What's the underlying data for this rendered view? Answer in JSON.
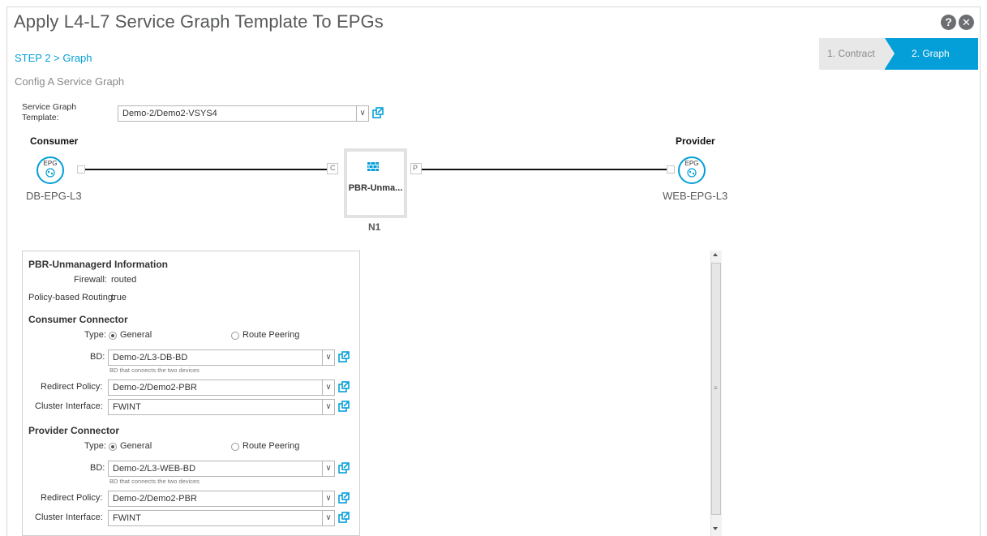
{
  "window": {
    "title": "Apply L4-L7 Service Graph Template To EPGs"
  },
  "header": {
    "help_icon": "question-mark",
    "close_icon": "x"
  },
  "breadcrumb": {
    "text": "STEP 2 > Graph"
  },
  "subtitle": "Config A Service Graph",
  "wizard": {
    "steps": [
      {
        "label": "1. Contract",
        "active": false
      },
      {
        "label": "2. Graph",
        "active": true
      }
    ],
    "accent": "#049fd9"
  },
  "template_field": {
    "label": "Service Graph Template:",
    "value": "Demo-2/Demo2-VSYS4"
  },
  "graph": {
    "consumer": {
      "title": "Consumer",
      "badge": "EPG",
      "name": "DB-EPG-L3"
    },
    "provider": {
      "title": "Provider",
      "badge": "EPG",
      "name": "WEB-EPG-L3"
    },
    "node": {
      "name": "PBR-Unma...",
      "id": "N1",
      "port_c": "C",
      "port_p": "P"
    }
  },
  "info": {
    "heading": "PBR-Unmanagerd Information",
    "firewall_label": "Firewall:",
    "firewall_value": "routed",
    "pbr_label": "Policy-based Routing:",
    "pbr_value": "true",
    "consumer": {
      "heading": "Consumer Connector",
      "type_label": "Type:",
      "type_general": "General",
      "type_route_peering": "Route Peering",
      "type_selected": "General",
      "bd_label": "BD:",
      "bd_value": "Demo-2/L3-DB-BD",
      "bd_hint": "BD that connects the two devices",
      "redirect_label": "Redirect Policy:",
      "redirect_value": "Demo-2/Demo2-PBR",
      "cluster_label": "Cluster Interface:",
      "cluster_value": "FWINT"
    },
    "provider": {
      "heading": "Provider Connector",
      "type_label": "Type:",
      "type_general": "General",
      "type_route_peering": "Route Peering",
      "type_selected": "General",
      "bd_label": "BD:",
      "bd_value": "Demo-2/L3-WEB-BD",
      "bd_hint": "BD that connects the two devices",
      "redirect_label": "Redirect Policy:",
      "redirect_value": "Demo-2/Demo2-PBR",
      "cluster_label": "Cluster Interface:",
      "cluster_value": "FWINT"
    }
  }
}
